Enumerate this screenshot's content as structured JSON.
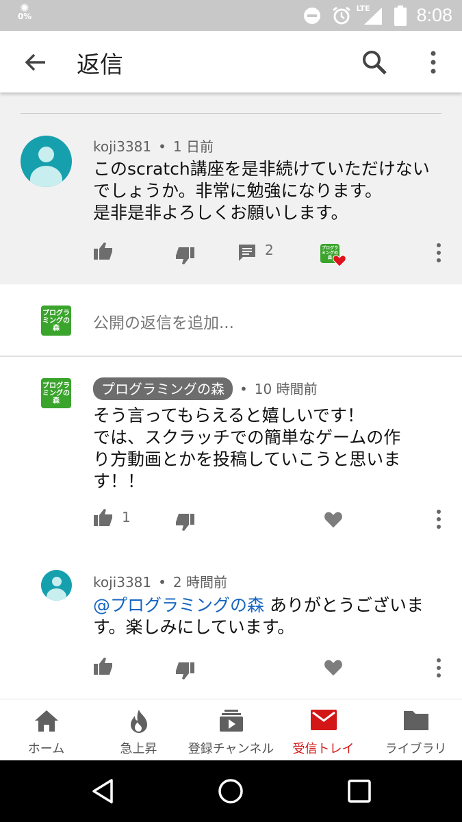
{
  "status_bar": {
    "battery_saver_text": "0%",
    "network": "LTE",
    "time": "8:08"
  },
  "app_bar": {
    "title": "返信"
  },
  "parent_comment": {
    "author": "koji3381",
    "time": "1 日前",
    "text_lines": [
      "このscratch講座を是非続けていただけない",
      "でしょうか。非常に勉強になります。",
      "是非是非よろしくお願いします。"
    ],
    "reply_count": "2",
    "creator_icon_text": "プログラミングの森"
  },
  "reply_input": {
    "placeholder": "公開の返信を追加..."
  },
  "replies": [
    {
      "author": "プログラミングの森",
      "author_badge": true,
      "time": "10 時間前",
      "text_lines": [
        "そう言ってもらえると嬉しいです！",
        "では、スクラッチでの簡単なゲームの作",
        "り方動画とかを投稿していこうと思いま",
        "す！！"
      ],
      "like_count": "1"
    },
    {
      "author": "koji3381",
      "author_badge": false,
      "time": "2 時間前",
      "mention": "@プログラミングの森",
      "text_first": " ありがとうございま",
      "text_second": "す。楽しみにしています。",
      "like_count": ""
    }
  ],
  "bottom_nav": {
    "items": [
      {
        "label": "ホーム",
        "icon": "home-icon"
      },
      {
        "label": "急上昇",
        "icon": "trending-fire-icon"
      },
      {
        "label": "登録チャンネル",
        "icon": "subscriptions-icon"
      },
      {
        "label": "受信トレイ",
        "icon": "inbox-mail-icon",
        "active": true
      },
      {
        "label": "ライブラリ",
        "icon": "library-folder-icon"
      }
    ]
  },
  "colors": {
    "accent_red": "#d31616",
    "avatar_teal": "#16a0ad",
    "channel_green": "#3aa42c",
    "mention_blue": "#1565c0"
  }
}
